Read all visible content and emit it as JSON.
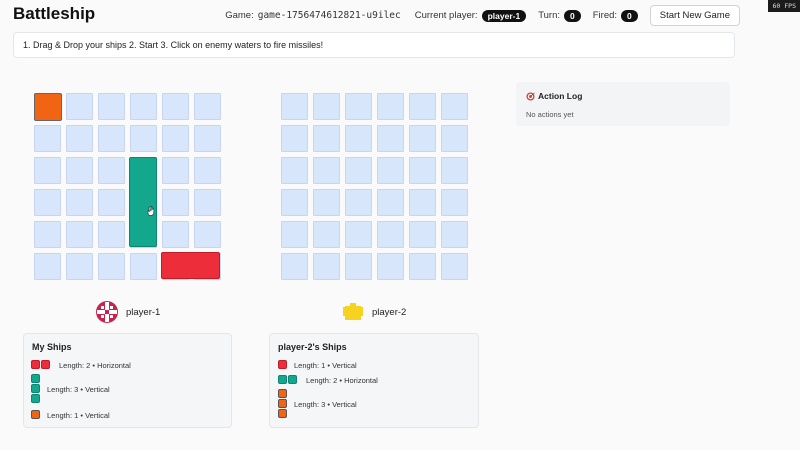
{
  "header": {
    "app_title": "Battleship",
    "game_label": "Game:",
    "game_id": "game-1756474612821-u9ilec",
    "current_player_label": "Current player:",
    "current_player": "player-1",
    "turn_label": "Turn:",
    "turn": "0",
    "fired_label": "Fired:",
    "fired": "0",
    "new_game_label": "Start New Game",
    "fps": "60 FPS"
  },
  "instructions": "1. Drag & Drop your ships 2. Start 3. Click on enemy waters to fire missiles!",
  "players": {
    "p1": {
      "name": "player-1"
    },
    "p2": {
      "name": "player-2"
    }
  },
  "my_ships": {
    "title": "My Ships",
    "items": [
      {
        "text": "Length: 2 • Horizontal",
        "color": "#ee2d3a"
      },
      {
        "text": "Length: 3 • Vertical",
        "color": "#13a88e"
      },
      {
        "text": "Length: 1 • Vertical",
        "color": "#f06414"
      }
    ]
  },
  "enemy_ships": {
    "title": "player-2's Ships",
    "items": [
      {
        "text": "Length: 1 • Vertical",
        "color": "#ee2d3a"
      },
      {
        "text": "Length: 2 • Horizontal",
        "color": "#13a88e"
      },
      {
        "text": "Length: 3 • Vertical",
        "color": "#f06414"
      }
    ]
  },
  "action_log": {
    "title": "Action Log",
    "empty_text": "No actions yet"
  },
  "board": {
    "rows": 6,
    "cols": 6
  },
  "colors": {
    "water": "#d8e6fc",
    "ship_red": "#ee2d3a",
    "ship_teal": "#13a88e",
    "ship_orange": "#f06414",
    "avatar_p1": "#c8234e",
    "avatar_p2": "#f7d21e"
  },
  "icons": {
    "avatar_p1": "pixel-cross-avatar-icon",
    "avatar_p2": "pixel-invader-avatar-icon",
    "action_log": "target-icon",
    "cursor": "grab-hand-icon"
  }
}
